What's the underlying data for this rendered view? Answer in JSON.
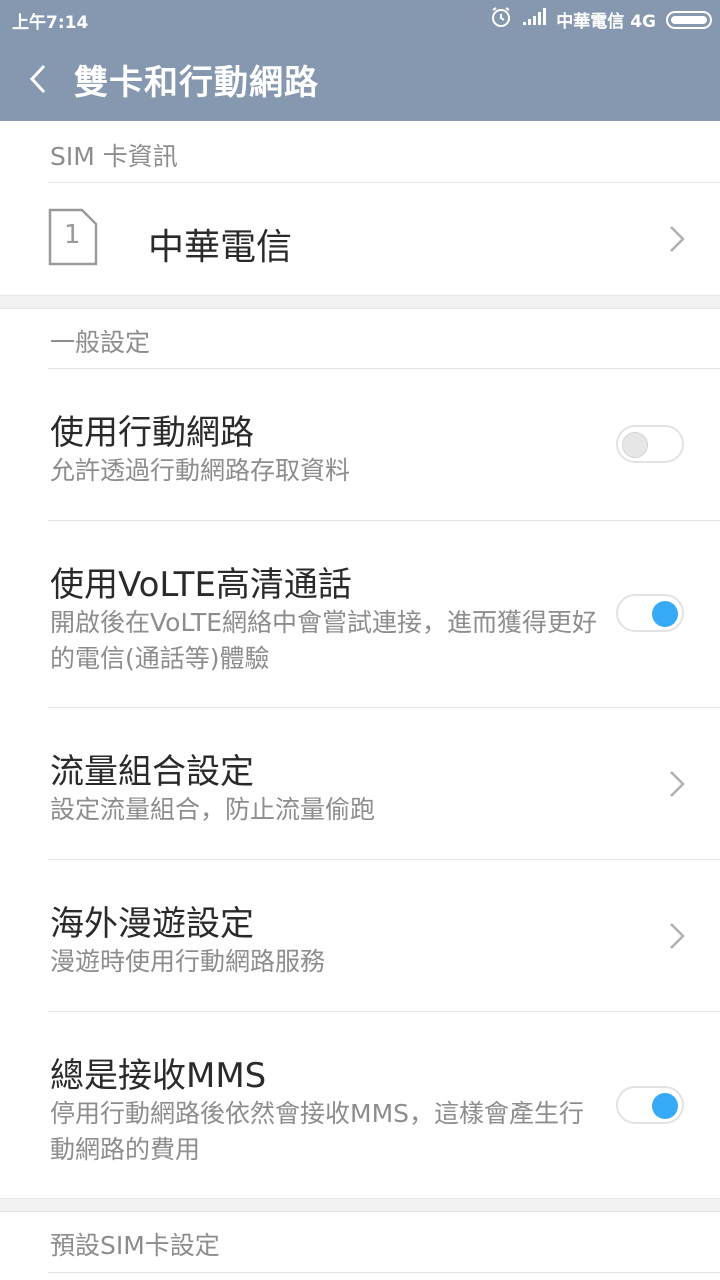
{
  "status_bar": {
    "time": "上午7:14",
    "carrier": "中華電信 4G"
  },
  "app_bar": {
    "title": "雙卡和行動網路"
  },
  "sim_info": {
    "header": "SIM 卡資訊",
    "sim_slot_number": "1",
    "carrier_name": "中華電信"
  },
  "general": {
    "header": "一般設定",
    "items": [
      {
        "title": "使用行動網路",
        "subtitle": "允許透過行動網路存取資料",
        "control": "toggle",
        "enabled": false
      },
      {
        "title": "使用VoLTE高清通話",
        "subtitle": "開啟後在VoLTE網絡中會嘗試連接，進而獲得更好的電信(通話等)體驗",
        "control": "toggle",
        "enabled": true
      },
      {
        "title": "流量組合設定",
        "subtitle": "設定流量組合，防止流量偷跑",
        "control": "chevron"
      },
      {
        "title": "海外漫遊設定",
        "subtitle": "漫遊時使用行動網路服務",
        "control": "chevron"
      },
      {
        "title": "總是接收MMS",
        "subtitle": "停用行動網路後依然會接收MMS，這樣會產生行動網路的費用",
        "control": "toggle",
        "enabled": true
      }
    ]
  },
  "default_sim": {
    "header": "預設SIM卡設定"
  },
  "colors": {
    "appbar": "#8598b0",
    "toggle_on": "#36a9f7",
    "text_primary": "#2a2a2a",
    "text_secondary": "#8d8d8d"
  }
}
